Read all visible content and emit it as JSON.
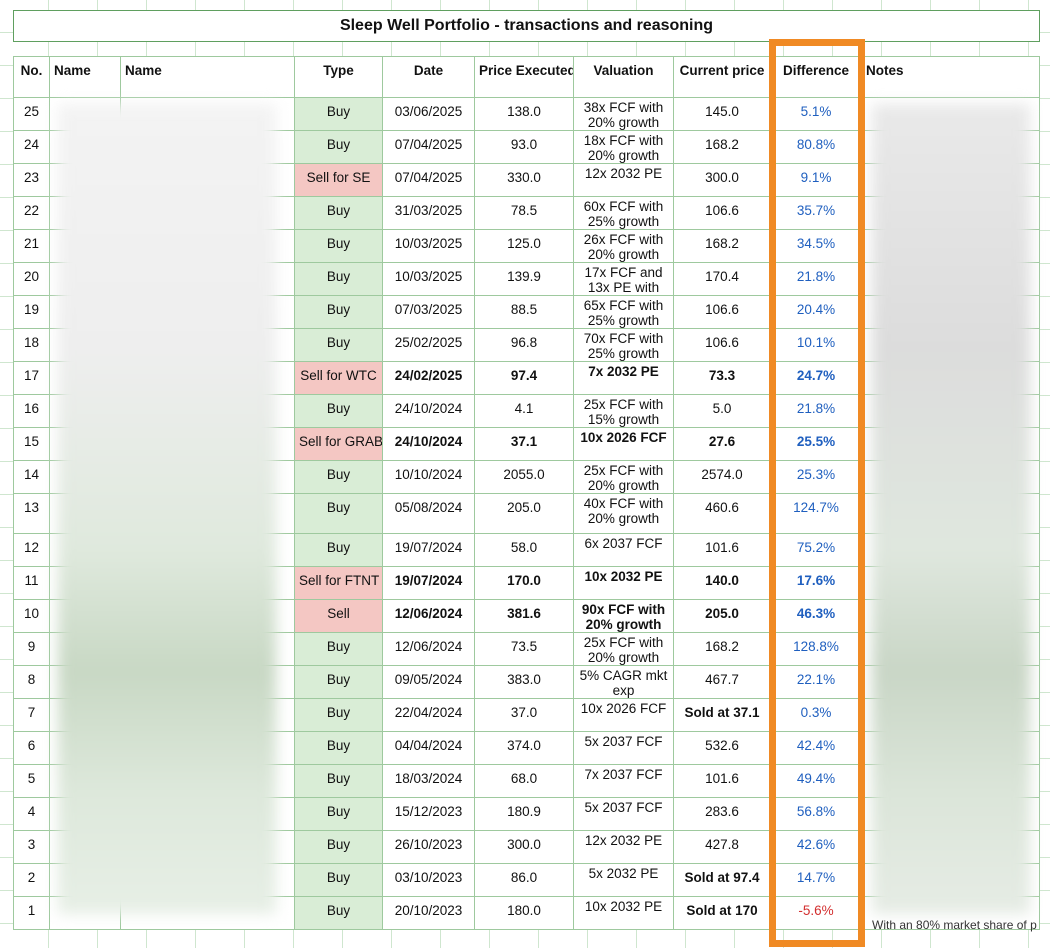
{
  "title": "Sleep Well Portfolio - transactions and reasoning",
  "headers": {
    "no": "No.",
    "name1": "Name",
    "name2": "Name",
    "type": "Type",
    "date": "Date",
    "price": "Price Executed",
    "valuation": "Valuation",
    "current": "Current price",
    "difference": "Difference",
    "notes": "Notes"
  },
  "rows": [
    {
      "no": "25",
      "type": "Buy",
      "date": "03/06/2025",
      "price": "138.0",
      "valuation": "38x FCF with 20% growth",
      "current": "145.0",
      "diff": "5.1%",
      "kind": "buy",
      "bold": false,
      "neg": false
    },
    {
      "no": "24",
      "type": "Buy",
      "date": "07/04/2025",
      "price": "93.0",
      "valuation": "18x FCF with 20% growth",
      "current": "168.2",
      "diff": "80.8%",
      "kind": "buy",
      "bold": false,
      "neg": false
    },
    {
      "no": "23",
      "type": "Sell for SE",
      "date": "07/04/2025",
      "price": "330.0",
      "valuation": "12x 2032 PE",
      "current": "300.0",
      "diff": "9.1%",
      "kind": "sell",
      "bold": false,
      "neg": false
    },
    {
      "no": "22",
      "type": "Buy",
      "date": "31/03/2025",
      "price": "78.5",
      "valuation": "60x FCF with 25% growth",
      "current": "106.6",
      "diff": "35.7%",
      "kind": "buy",
      "bold": false,
      "neg": false
    },
    {
      "no": "21",
      "type": "Buy",
      "date": "10/03/2025",
      "price": "125.0",
      "valuation": "26x FCF with 20% growth",
      "current": "168.2",
      "diff": "34.5%",
      "kind": "buy",
      "bold": false,
      "neg": false
    },
    {
      "no": "20",
      "type": "Buy",
      "date": "10/03/2025",
      "price": "139.9",
      "valuation": "17x FCF and 13x PE with",
      "current": "170.4",
      "diff": "21.8%",
      "kind": "buy",
      "bold": false,
      "neg": false
    },
    {
      "no": "19",
      "type": "Buy",
      "date": "07/03/2025",
      "price": "88.5",
      "valuation": "65x FCF with 25% growth",
      "current": "106.6",
      "diff": "20.4%",
      "kind": "buy",
      "bold": false,
      "neg": false
    },
    {
      "no": "18",
      "type": "Buy",
      "date": "25/02/2025",
      "price": "96.8",
      "valuation": "70x FCF with 25% growth",
      "current": "106.6",
      "diff": "10.1%",
      "kind": "buy",
      "bold": false,
      "neg": false
    },
    {
      "no": "17",
      "type": "Sell for WTC",
      "date": "24/02/2025",
      "price": "97.4",
      "valuation": "7x 2032 PE",
      "current": "73.3",
      "diff": "24.7%",
      "kind": "sell",
      "bold": true,
      "neg": false
    },
    {
      "no": "16",
      "type": "Buy",
      "date": "24/10/2024",
      "price": "4.1",
      "valuation": "25x FCF with 15% growth",
      "current": "5.0",
      "diff": "21.8%",
      "kind": "buy",
      "bold": false,
      "neg": false
    },
    {
      "no": "15",
      "type": "Sell for GRAB",
      "date": "24/10/2024",
      "price": "37.1",
      "valuation": "10x 2026 FCF",
      "current": "27.6",
      "diff": "25.5%",
      "kind": "sell",
      "bold": true,
      "neg": false
    },
    {
      "no": "14",
      "type": "Buy",
      "date": "10/10/2024",
      "price": "2055.0",
      "valuation": "25x FCF with 20% growth",
      "current": "2574.0",
      "diff": "25.3%",
      "kind": "buy",
      "bold": false,
      "neg": false
    },
    {
      "no": "13",
      "type": "Buy",
      "date": "05/08/2024",
      "price": "205.0",
      "valuation": "40x FCF with 20% growth",
      "current": "460.6",
      "diff": "124.7%",
      "kind": "buy",
      "bold": false,
      "neg": false,
      "tall": true
    },
    {
      "no": "12",
      "type": "Buy",
      "date": "19/07/2024",
      "price": "58.0",
      "valuation": "6x 2037 FCF",
      "current": "101.6",
      "diff": "75.2%",
      "kind": "buy",
      "bold": false,
      "neg": false
    },
    {
      "no": "11",
      "type": "Sell for FTNT",
      "date": "19/07/2024",
      "price": "170.0",
      "valuation": "10x 2032 PE",
      "current": "140.0",
      "diff": "17.6%",
      "kind": "sell",
      "bold": true,
      "neg": false
    },
    {
      "no": "10",
      "type": "Sell",
      "date": "12/06/2024",
      "price": "381.6",
      "valuation": "90x FCF with 20% growth",
      "current": "205.0",
      "diff": "46.3%",
      "kind": "sell",
      "bold": true,
      "neg": false
    },
    {
      "no": "9",
      "type": "Buy",
      "date": "12/06/2024",
      "price": "73.5",
      "valuation": "25x FCF with 20% growth",
      "current": "168.2",
      "diff": "128.8%",
      "kind": "buy",
      "bold": false,
      "neg": false
    },
    {
      "no": "8",
      "type": "Buy",
      "date": "09/05/2024",
      "price": "383.0",
      "valuation": "5% CAGR mkt exp",
      "current": "467.7",
      "diff": "22.1%",
      "kind": "buy",
      "bold": false,
      "neg": false
    },
    {
      "no": "7",
      "type": "Buy",
      "date": "22/04/2024",
      "price": "37.0",
      "valuation": "10x 2026 FCF",
      "current": "Sold at 37.1",
      "diff": "0.3%",
      "kind": "buy",
      "bold": false,
      "neg": false,
      "boldCurrent": true
    },
    {
      "no": "6",
      "type": "Buy",
      "date": "04/04/2024",
      "price": "374.0",
      "valuation": "5x 2037 FCF",
      "current": "532.6",
      "diff": "42.4%",
      "kind": "buy",
      "bold": false,
      "neg": false
    },
    {
      "no": "5",
      "type": "Buy",
      "date": "18/03/2024",
      "price": "68.0",
      "valuation": "7x 2037 FCF",
      "current": "101.6",
      "diff": "49.4%",
      "kind": "buy",
      "bold": false,
      "neg": false
    },
    {
      "no": "4",
      "type": "Buy",
      "date": "15/12/2023",
      "price": "180.9",
      "valuation": "5x 2037 FCF",
      "current": "283.6",
      "diff": "56.8%",
      "kind": "buy",
      "bold": false,
      "neg": false
    },
    {
      "no": "3",
      "type": "Buy",
      "date": "26/10/2023",
      "price": "300.0",
      "valuation": "12x 2032 PE",
      "current": "427.8",
      "diff": "42.6%",
      "kind": "buy",
      "bold": false,
      "neg": false
    },
    {
      "no": "2",
      "type": "Buy",
      "date": "03/10/2023",
      "price": "86.0",
      "valuation": "5x 2032 PE",
      "current": "Sold at 97.4",
      "diff": "14.7%",
      "kind": "buy",
      "bold": false,
      "neg": false,
      "boldCurrent": true
    },
    {
      "no": "1",
      "type": "Buy",
      "date": "20/10/2023",
      "price": "180.0",
      "valuation": "10x 2032 PE",
      "current": "Sold at 170",
      "diff": "-5.6%",
      "kind": "buy",
      "bold": false,
      "neg": true,
      "boldCurrent": true
    }
  ],
  "footnote": "With an 80% market share of p",
  "colors": {
    "accent_highlight": "#f08a24",
    "buy_fill": "#d9edd6",
    "sell_fill": "#f4c7c3",
    "diff_positive": "#1f5fbf",
    "diff_negative": "#d32f2f"
  }
}
